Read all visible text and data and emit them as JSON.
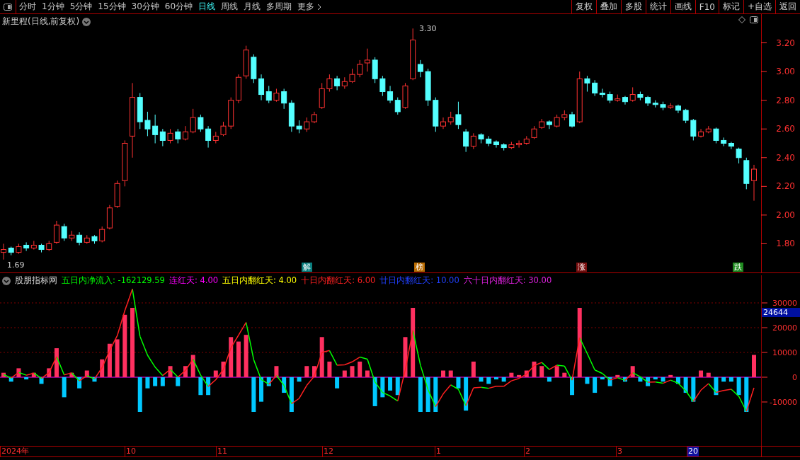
{
  "toolbar": {
    "periods": [
      {
        "label": "分时",
        "selected": false
      },
      {
        "label": "1分钟",
        "selected": false
      },
      {
        "label": "5分钟",
        "selected": false
      },
      {
        "label": "15分钟",
        "selected": false
      },
      {
        "label": "30分钟",
        "selected": false
      },
      {
        "label": "60分钟",
        "selected": false
      },
      {
        "label": "日线",
        "selected": true
      },
      {
        "label": "周线",
        "selected": false
      },
      {
        "label": "月线",
        "selected": false
      },
      {
        "label": "多周期",
        "selected": false
      },
      {
        "label": "更多",
        "selected": false
      }
    ],
    "actions": [
      "复权",
      "叠加",
      "多股",
      "统计",
      "画线",
      "F10",
      "标记",
      "+自选",
      "返回"
    ]
  },
  "price_chart": {
    "title": "新里程(日线,前复权)",
    "high_label": "3.30",
    "low_label": "1.69",
    "signals": [
      {
        "label": "解",
        "color": "#0a7f7f"
      },
      {
        "label": "榜",
        "color": "#b86a00"
      },
      {
        "label": "涨",
        "color": "#7a1010"
      },
      {
        "label": "跌",
        "color": "#1f8a1f"
      }
    ],
    "chart_data": {
      "type": "candlestick",
      "ylim": [
        1.6,
        3.4
      ],
      "yticks": [
        {
          "value": 3.2,
          "label": "3.20"
        },
        {
          "value": 3.0,
          "label": "3.00"
        },
        {
          "value": 2.8,
          "label": "2.80"
        },
        {
          "value": 2.6,
          "label": "2.60"
        },
        {
          "value": 2.4,
          "label": "2.40"
        },
        {
          "value": 2.2,
          "label": "2.20"
        },
        {
          "value": 2.0,
          "label": "2.00"
        },
        {
          "value": 1.8,
          "label": "1.80"
        }
      ],
      "ohlc": [
        [
          1.74,
          1.8,
          1.69,
          1.76
        ],
        [
          1.77,
          1.78,
          1.72,
          1.74
        ],
        [
          1.74,
          1.8,
          1.73,
          1.78
        ],
        [
          1.79,
          1.81,
          1.75,
          1.77
        ],
        [
          1.77,
          1.82,
          1.76,
          1.79
        ],
        [
          1.79,
          1.8,
          1.74,
          1.76
        ],
        [
          1.76,
          1.82,
          1.75,
          1.8
        ],
        [
          1.81,
          1.96,
          1.8,
          1.93
        ],
        [
          1.92,
          1.94,
          1.82,
          1.84
        ],
        [
          1.84,
          1.89,
          1.82,
          1.86
        ],
        [
          1.86,
          1.88,
          1.79,
          1.81
        ],
        [
          1.81,
          1.86,
          1.8,
          1.84
        ],
        [
          1.85,
          1.86,
          1.8,
          1.82
        ],
        [
          1.82,
          1.92,
          1.81,
          1.9
        ],
        [
          1.91,
          2.07,
          1.9,
          2.05
        ],
        [
          2.06,
          2.24,
          2.05,
          2.22
        ],
        [
          2.24,
          2.52,
          2.2,
          2.5
        ],
        [
          2.55,
          2.92,
          2.4,
          2.82
        ],
        [
          2.82,
          2.85,
          2.6,
          2.65
        ],
        [
          2.66,
          2.72,
          2.55,
          2.6
        ],
        [
          2.62,
          2.7,
          2.5,
          2.56
        ],
        [
          2.58,
          2.6,
          2.48,
          2.52
        ],
        [
          2.52,
          2.6,
          2.5,
          2.57
        ],
        [
          2.58,
          2.6,
          2.5,
          2.53
        ],
        [
          2.53,
          2.62,
          2.52,
          2.58
        ],
        [
          2.58,
          2.74,
          2.57,
          2.68
        ],
        [
          2.68,
          2.7,
          2.58,
          2.6
        ],
        [
          2.6,
          2.62,
          2.47,
          2.52
        ],
        [
          2.52,
          2.58,
          2.5,
          2.55
        ],
        [
          2.56,
          2.65,
          2.55,
          2.62
        ],
        [
          2.62,
          2.82,
          2.6,
          2.8
        ],
        [
          2.8,
          2.98,
          2.78,
          2.96
        ],
        [
          2.97,
          3.18,
          2.95,
          3.15
        ],
        [
          3.1,
          3.12,
          2.92,
          2.95
        ],
        [
          2.95,
          2.98,
          2.8,
          2.84
        ],
        [
          2.86,
          2.9,
          2.78,
          2.8
        ],
        [
          2.8,
          2.88,
          2.79,
          2.85
        ],
        [
          2.86,
          2.88,
          2.74,
          2.78
        ],
        [
          2.78,
          2.8,
          2.58,
          2.62
        ],
        [
          2.62,
          2.66,
          2.57,
          2.6
        ],
        [
          2.6,
          2.68,
          2.58,
          2.65
        ],
        [
          2.65,
          2.72,
          2.64,
          2.7
        ],
        [
          2.75,
          2.92,
          2.74,
          2.88
        ],
        [
          2.88,
          2.98,
          2.86,
          2.95
        ],
        [
          2.95,
          2.97,
          2.87,
          2.9
        ],
        [
          2.9,
          2.96,
          2.88,
          2.93
        ],
        [
          2.93,
          3.02,
          2.92,
          2.98
        ],
        [
          2.98,
          3.08,
          2.96,
          3.05
        ],
        [
          3.06,
          3.16,
          3.0,
          3.08
        ],
        [
          3.08,
          3.1,
          2.92,
          2.95
        ],
        [
          2.95,
          2.97,
          2.83,
          2.86
        ],
        [
          2.86,
          2.9,
          2.78,
          2.8
        ],
        [
          2.8,
          2.82,
          2.7,
          2.72
        ],
        [
          2.75,
          2.92,
          2.74,
          2.9
        ],
        [
          2.95,
          3.3,
          2.94,
          3.22
        ],
        [
          3.05,
          3.08,
          2.96,
          3.0
        ],
        [
          3.0,
          3.02,
          2.76,
          2.8
        ],
        [
          2.8,
          2.82,
          2.58,
          2.62
        ],
        [
          2.62,
          2.68,
          2.6,
          2.65
        ],
        [
          2.65,
          2.72,
          2.63,
          2.68
        ],
        [
          2.7,
          2.79,
          2.6,
          2.63
        ],
        [
          2.58,
          2.6,
          2.44,
          2.48
        ],
        [
          2.48,
          2.57,
          2.46,
          2.55
        ],
        [
          2.56,
          2.57,
          2.5,
          2.53
        ],
        [
          2.53,
          2.55,
          2.48,
          2.5
        ],
        [
          2.51,
          2.52,
          2.47,
          2.49
        ],
        [
          2.49,
          2.5,
          2.45,
          2.47
        ],
        [
          2.47,
          2.51,
          2.46,
          2.49
        ],
        [
          2.49,
          2.52,
          2.47,
          2.5
        ],
        [
          2.5,
          2.55,
          2.49,
          2.53
        ],
        [
          2.54,
          2.62,
          2.53,
          2.6
        ],
        [
          2.61,
          2.67,
          2.6,
          2.65
        ],
        [
          2.65,
          2.66,
          2.6,
          2.63
        ],
        [
          2.62,
          2.7,
          2.61,
          2.68
        ],
        [
          2.68,
          2.73,
          2.66,
          2.7
        ],
        [
          2.7,
          2.72,
          2.61,
          2.62
        ],
        [
          2.65,
          3.0,
          2.64,
          2.95
        ],
        [
          2.95,
          2.97,
          2.86,
          2.92
        ],
        [
          2.92,
          2.94,
          2.83,
          2.85
        ],
        [
          2.85,
          2.88,
          2.82,
          2.84
        ],
        [
          2.84,
          2.86,
          2.78,
          2.8
        ],
        [
          2.8,
          2.84,
          2.79,
          2.81
        ],
        [
          2.82,
          2.83,
          2.77,
          2.79
        ],
        [
          2.8,
          2.89,
          2.79,
          2.84
        ],
        [
          2.84,
          2.86,
          2.8,
          2.82
        ],
        [
          2.82,
          2.83,
          2.76,
          2.78
        ],
        [
          2.78,
          2.8,
          2.75,
          2.77
        ],
        [
          2.77,
          2.79,
          2.73,
          2.75
        ],
        [
          2.75,
          2.78,
          2.74,
          2.76
        ],
        [
          2.76,
          2.77,
          2.71,
          2.73
        ],
        [
          2.73,
          2.74,
          2.64,
          2.66
        ],
        [
          2.66,
          2.67,
          2.52,
          2.55
        ],
        [
          2.55,
          2.6,
          2.54,
          2.58
        ],
        [
          2.58,
          2.62,
          2.57,
          2.6
        ],
        [
          2.6,
          2.61,
          2.5,
          2.52
        ],
        [
          2.52,
          2.54,
          2.48,
          2.5
        ],
        [
          2.5,
          2.51,
          2.46,
          2.48
        ],
        [
          2.46,
          2.47,
          2.36,
          2.4
        ],
        [
          2.38,
          2.4,
          2.18,
          2.22
        ],
        [
          2.24,
          2.35,
          2.1,
          2.32
        ]
      ]
    }
  },
  "indicator": {
    "name": "股朋指标网",
    "legend": [
      {
        "label": "五日内净流入: -162129.59",
        "color": "#00ff00"
      },
      {
        "label": "连红天: 4.00",
        "color": "#ff00ff"
      },
      {
        "label": "五日内翻红天: 4.00",
        "color": "#ffff00"
      },
      {
        "label": "十日内翻红天: 6.00",
        "color": "#ff2020"
      },
      {
        "label": "廿日内翻红天: 10.00",
        "color": "#2040ff"
      },
      {
        "label": "六十日内翻红天: 30.00",
        "color": "#e020e0"
      }
    ],
    "yticks": [
      "30000",
      "20000",
      "10000",
      "0",
      "-10000"
    ],
    "current_value": "24644"
  },
  "date_axis": [
    {
      "label": "2024年",
      "selected": false
    },
    {
      "label": "10",
      "selected": false
    },
    {
      "label": "11",
      "selected": false
    },
    {
      "label": "12",
      "selected": false
    },
    {
      "label": "1",
      "selected": false
    },
    {
      "label": "2",
      "selected": false
    },
    {
      "label": "3",
      "selected": false
    },
    {
      "label": "20",
      "selected": true
    }
  ]
}
